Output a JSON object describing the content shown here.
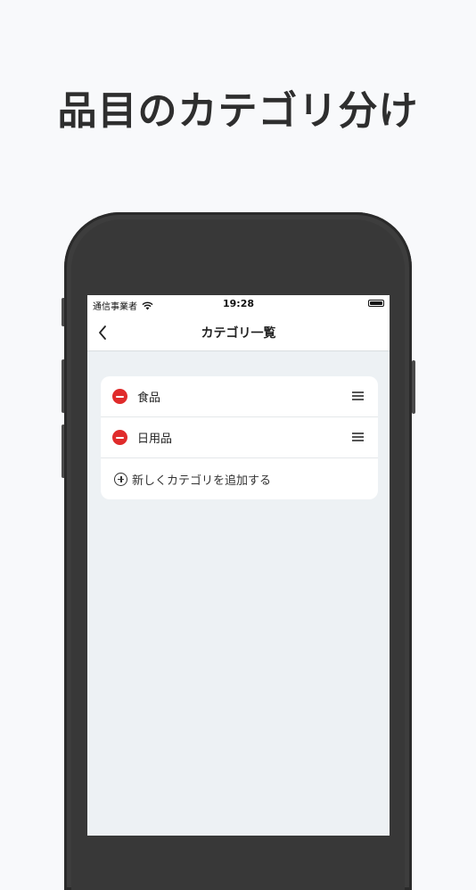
{
  "headline": "品目のカテゴリ分け",
  "status_bar": {
    "carrier": "通信事業者",
    "time": "19:28"
  },
  "nav": {
    "title": "カテゴリ一覧",
    "back_icon": "chevron-left-icon"
  },
  "categories": [
    {
      "label": "食品"
    },
    {
      "label": "日用品"
    }
  ],
  "add_label": "新しくカテゴリを追加する",
  "colors": {
    "delete": "#e02b2b",
    "list_background": "#edf1f4",
    "card": "#ffffff"
  }
}
